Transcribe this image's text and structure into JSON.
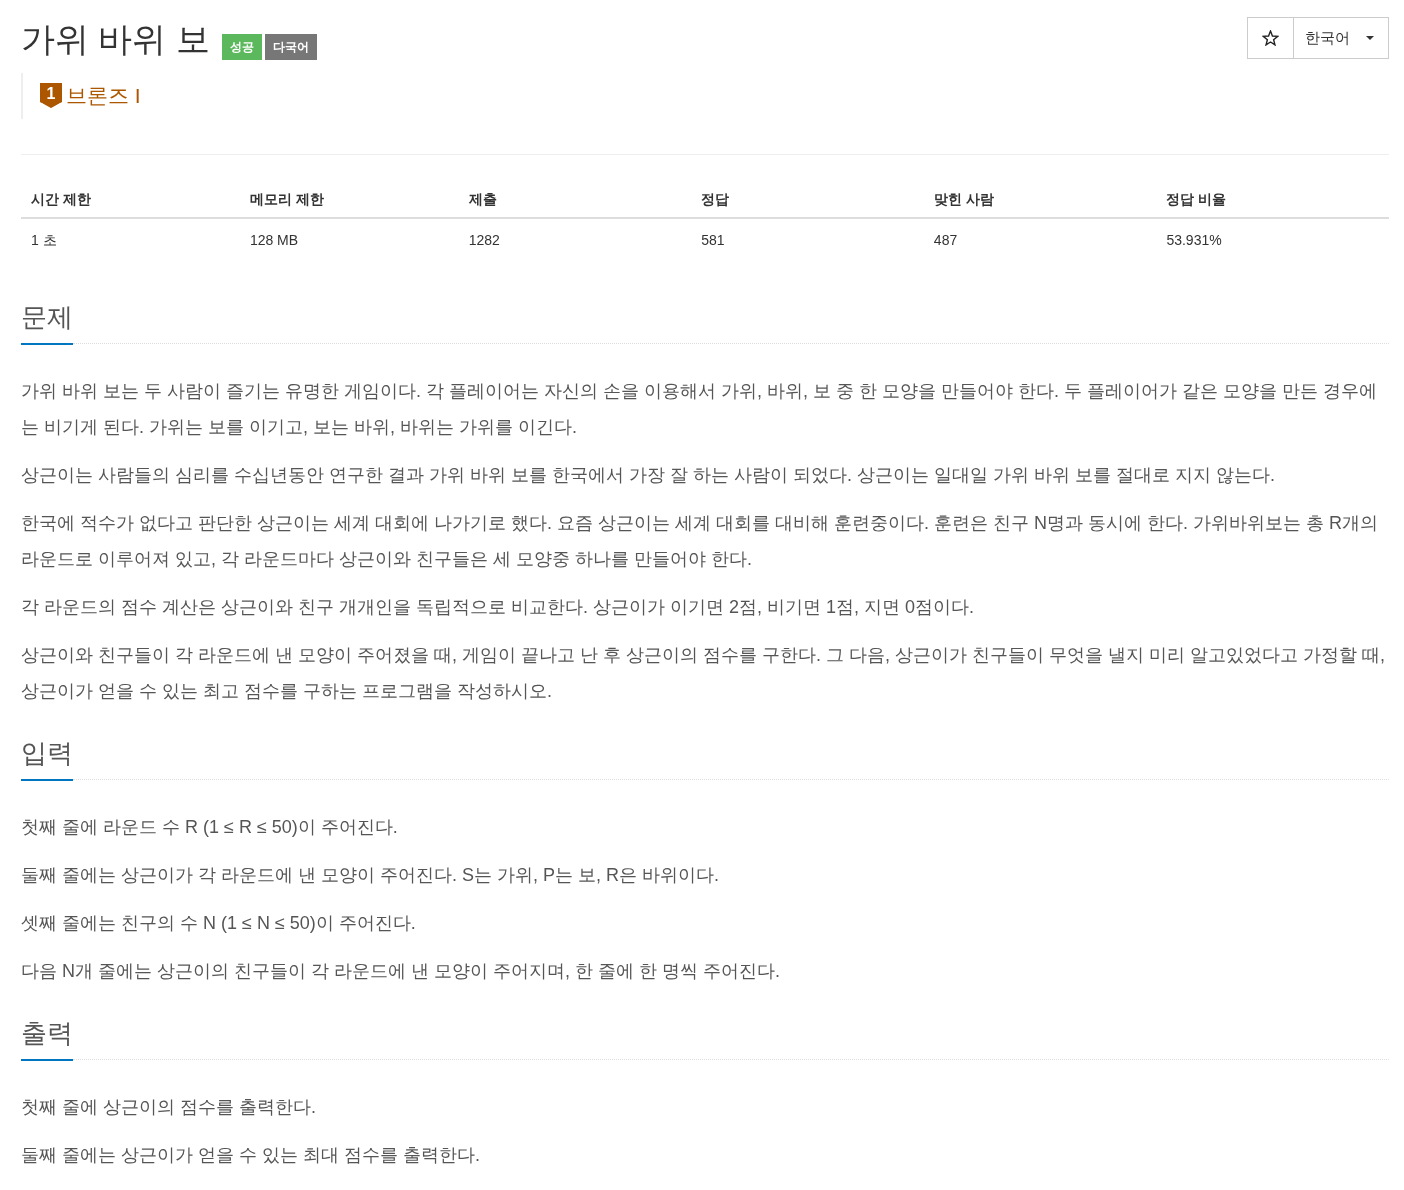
{
  "problem": {
    "title": "가위 바위 보",
    "badges": [
      {
        "label": "성공",
        "color": "#5cb85c"
      },
      {
        "label": "다국어",
        "color": "#777777"
      }
    ]
  },
  "toolbar": {
    "star_button": {
      "selected": false
    },
    "language_dropdown": {
      "value": "한국어"
    }
  },
  "tier": {
    "icon_number": "1",
    "label": "브론즈 I"
  },
  "info_table": {
    "columns": [
      "시간 제한",
      "메모리 제한",
      "제출",
      "정답",
      "맞힌 사람",
      "정답 비율"
    ],
    "rows": [
      [
        "1 초",
        "128 MB",
        "1282",
        "581",
        "487",
        "53.931%"
      ]
    ]
  },
  "sections": [
    {
      "heading": "문제",
      "paragraphs": [
        "가위 바위 보는 두 사람이 즐기는 유명한 게임이다. 각 플레이어는 자신의 손을 이용해서 가위, 바위, 보 중 한 모양을 만들어야 한다. 두 플레이어가 같은 모양을 만든 경우에는 비기게 된다. 가위는 보를 이기고, 보는 바위, 바위는 가위를 이긴다.",
        "상근이는 사람들의 심리를 수십년동안 연구한 결과 가위 바위 보를 한국에서 가장 잘 하는 사람이 되었다. 상근이는 일대일 가위 바위 보를 절대로 지지 않는다.",
        "한국에 적수가 없다고 판단한 상근이는 세계 대회에 나가기로 했다. 요즘 상근이는 세계 대회를 대비해 훈련중이다. 훈련은 친구 N명과 동시에 한다. 가위바위보는 총 R개의 라운드로 이루어져 있고, 각 라운드마다 상근이와 친구들은 세 모양중 하나를 만들어야 한다.",
        "각 라운드의 점수 계산은 상근이와 친구 개개인을 독립적으로 비교한다. 상근이가 이기면 2점, 비기면 1점, 지면 0점이다.",
        "상근이와 친구들이 각 라운드에 낸 모양이 주어졌을 때, 게임이 끝나고 난 후 상근이의 점수를 구한다. 그 다음, 상근이가 친구들이 무엇을 낼지 미리 알고있었다고 가정할 때, 상근이가 얻을 수 있는 최고 점수를 구하는 프로그램을 작성하시오."
      ]
    },
    {
      "heading": "입력",
      "paragraphs": [
        "첫째 줄에 라운드 수 R (1 ≤ R ≤ 50)이 주어진다.",
        "둘째 줄에는 상근이가 각 라운드에 낸 모양이 주어진다. S는 가위, P는 보, R은 바위이다.",
        "셋째 줄에는 친구의 수 N (1 ≤ N ≤ 50)이 주어진다.",
        "다음 N개 줄에는 상근이의 친구들이 각 라운드에 낸 모양이 주어지며, 한 줄에 한 명씩 주어진다."
      ]
    },
    {
      "heading": "출력",
      "paragraphs": [
        "첫째 줄에 상근이의 점수를 출력한다.",
        "둘째 줄에는 상근이가 얻을 수 있는 최대 점수를 출력한다."
      ]
    }
  ]
}
